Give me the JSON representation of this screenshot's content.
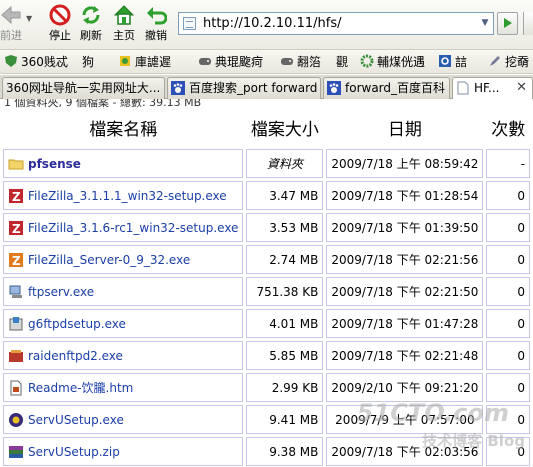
{
  "toolbar": {
    "back_label": "前进",
    "stop_label": "停止",
    "refresh_label": "刷新",
    "home_label": "主页",
    "undo_label": "撤销",
    "address": "http://10.2.10.11/hfs/"
  },
  "favorites": [
    {
      "label": "360贱忒",
      "icon": "shield-icon"
    },
    {
      "label": "狗",
      "icon": "plugin-icon"
    },
    {
      "label": "庫謔遲",
      "icon": "puzzle-icon"
    },
    {
      "label": "典琨颴疴",
      "icon": "gamepad-icon"
    },
    {
      "label": "翿箈",
      "icon": "gamepad-icon"
    },
    {
      "label": "觀",
      "icon": "text"
    },
    {
      "label": "輔煤侊遇",
      "icon": "gear-icon"
    },
    {
      "label": "誩",
      "icon": "q-icon"
    },
    {
      "label": "挖奣",
      "icon": "pen-icon"
    }
  ],
  "tabs": [
    {
      "label": "360网址导航一实用网址大...",
      "icon": "page-icon"
    },
    {
      "label": "百度搜索_port forward",
      "icon": "paw-icon"
    },
    {
      "label": "forward_百度百科",
      "icon": "paw-icon"
    },
    {
      "label": "HF...",
      "icon": "page-icon",
      "active": true
    }
  ],
  "summary": "1 個資料夾, 9 個檔案 - 總數: 39.13 MB",
  "table": {
    "headers": [
      "檔案名稱",
      "檔案大小",
      "日期",
      "次數"
    ],
    "rows": [
      {
        "name": "pfsense",
        "size": "資料夾",
        "date": "2009/7/18 上午 08:59:42",
        "hits": "-",
        "icon": "folder-icon",
        "folder": true
      },
      {
        "name": "FileZilla_3.1.1.1_win32-setup.exe",
        "size": "3.47 MB",
        "date": "2009/7/18 下午 01:28:54",
        "hits": "0",
        "icon": "filezilla-icon"
      },
      {
        "name": "FileZilla_3.1.6-rc1_win32-setup.exe",
        "size": "3.53 MB",
        "date": "2009/7/18 下午 01:39:50",
        "hits": "0",
        "icon": "filezilla-icon"
      },
      {
        "name": "FileZilla_Server-0_9_32.exe",
        "size": "2.74 MB",
        "date": "2009/7/18 下午 02:21:56",
        "hits": "0",
        "icon": "filezilla-server-icon"
      },
      {
        "name": "ftpserv.exe",
        "size": "751.38 KB",
        "date": "2009/7/18 下午 02:21:50",
        "hits": "0",
        "icon": "computer-icon"
      },
      {
        "name": "g6ftpdsetup.exe",
        "size": "4.01 MB",
        "date": "2009/7/18 下午 01:47:28",
        "hits": "0",
        "icon": "installer-icon"
      },
      {
        "name": "raidenftpd2.exe",
        "size": "5.85 MB",
        "date": "2009/7/18 下午 02:21:48",
        "hits": "0",
        "icon": "raiden-icon"
      },
      {
        "name": "Readme-饮朧.htm",
        "size": "2.99 KB",
        "date": "2009/2/10 下午 09:21:20",
        "hits": "0",
        "icon": "html-file-icon"
      },
      {
        "name": "ServUSetup.exe",
        "size": "9.41 MB",
        "date": "2009/7/9 上午 07:57:00",
        "hits": "0",
        "icon": "servu-icon"
      },
      {
        "name": "ServUSetup.zip",
        "size": "9.38 MB",
        "date": "2009/7/18 下午 02:03:56",
        "hits": "0",
        "icon": "zip-icon"
      }
    ]
  },
  "watermark": {
    "line1": "51CTO.com",
    "line2": "技术博客 Blog"
  }
}
